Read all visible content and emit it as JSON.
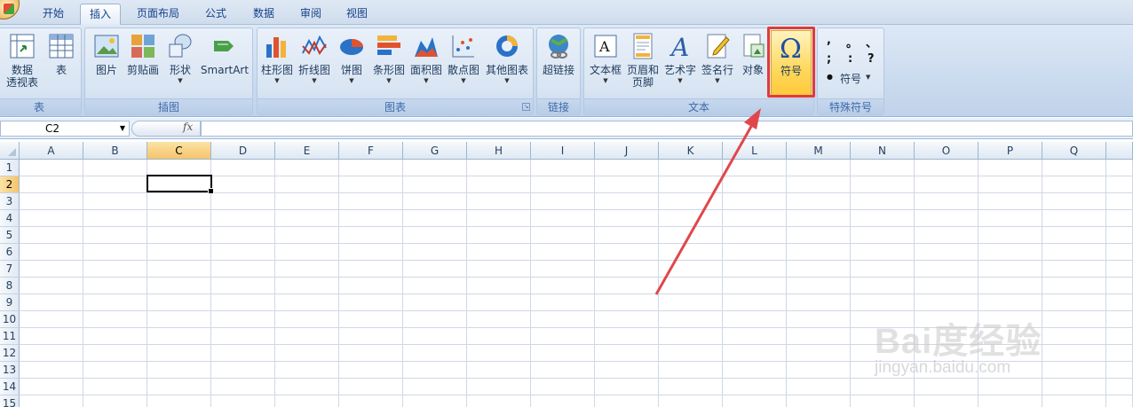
{
  "tabs": [
    "开始",
    "插入",
    "页面布局",
    "公式",
    "数据",
    "审阅",
    "视图"
  ],
  "active_tab": "插入",
  "ribbon": {
    "groups": {
      "table": "表",
      "illustrations": "插图",
      "charts": "图表",
      "links": "链接",
      "text": "文本",
      "special_symbols": "特殊符号"
    },
    "buttons": {
      "pivot_line1": "数据",
      "pivot_line2": "透视表",
      "table": "表",
      "picture": "图片",
      "clipart": "剪贴画",
      "shapes": "形状",
      "smartart": "SmartArt",
      "column": "柱形图",
      "line": "折线图",
      "pie": "饼图",
      "bar": "条形图",
      "area": "面积图",
      "scatter": "散点图",
      "other_charts": "其他图表",
      "hyperlink": "超链接",
      "textbox": "文本框",
      "header_line1": "页眉和",
      "header_line2": "页脚",
      "wordart": "艺术字",
      "signature": "签名行",
      "object": "对象",
      "symbol": "符号",
      "symbol_small": "符号"
    },
    "special_chars": [
      ",",
      "。",
      "、",
      ";",
      ":",
      "?"
    ],
    "dot_char": "●"
  },
  "formula_bar": {
    "name_box": "C2",
    "fx": "fx",
    "value": ""
  },
  "grid": {
    "columns": [
      "A",
      "B",
      "C",
      "D",
      "E",
      "F",
      "G",
      "H",
      "I",
      "J",
      "K",
      "L",
      "M",
      "N",
      "O",
      "P",
      "Q"
    ],
    "rows": [
      "1",
      "2",
      "3",
      "4",
      "5",
      "6",
      "7",
      "8",
      "9",
      "10",
      "11",
      "12",
      "13",
      "14",
      "15"
    ],
    "selected_column": "C",
    "selected_row": "2"
  },
  "watermark": {
    "logo": "Bai度经验",
    "url": "jingyan.baidu.com"
  },
  "colors": {
    "highlight_box": "#e23a3a",
    "arrow": "#e0474c",
    "selected_header": "#f5c46a"
  }
}
